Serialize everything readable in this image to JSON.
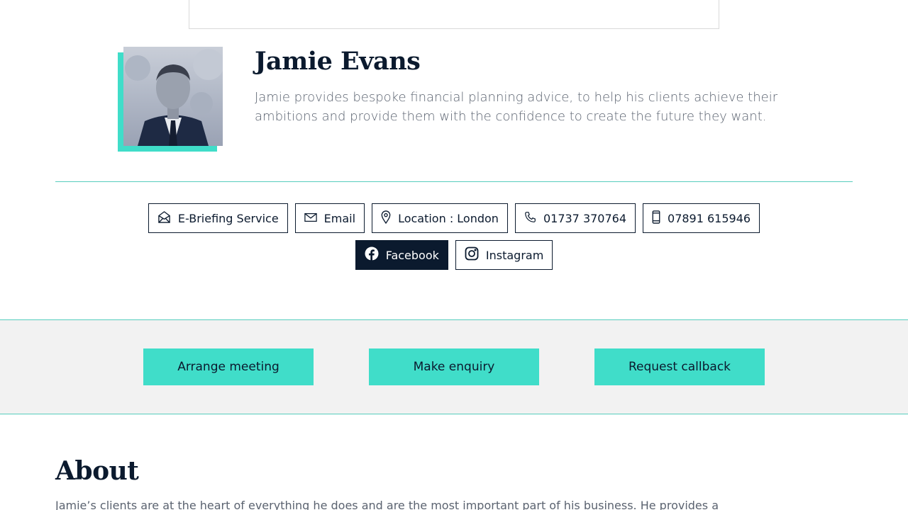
{
  "profile": {
    "name": "Jamie Evans",
    "bio": "Jamie provides bespoke financial planning advice, to help his clients achieve their ambitions and provide them with the confidence to create the future they want."
  },
  "contacts": {
    "ebriefing": {
      "label": "E-Briefing Service",
      "icon": "envelope-open-icon"
    },
    "email": {
      "label": "Email",
      "icon": "envelope-icon"
    },
    "location": {
      "label": "Location : London",
      "icon": "map-pin-icon"
    },
    "phone": {
      "label": "01737 370764",
      "icon": "phone-icon"
    },
    "mobile": {
      "label": "07891 615946",
      "icon": "mobile-icon"
    },
    "facebook": {
      "label": "Facebook",
      "icon": "facebook-icon"
    },
    "instagram": {
      "label": "Instagram",
      "icon": "instagram-icon"
    }
  },
  "cta": {
    "arrange_meeting": "Arrange meeting",
    "make_enquiry": "Make enquiry",
    "request_callback": "Request callback"
  },
  "about": {
    "title": "About",
    "text": "Jamie’s clients are at the heart of everything he does and are the most important part of his business. He provides a"
  },
  "colors": {
    "accent": "#40ddc9",
    "navy": "#0b1a2e",
    "band": "#f2f2f2"
  }
}
